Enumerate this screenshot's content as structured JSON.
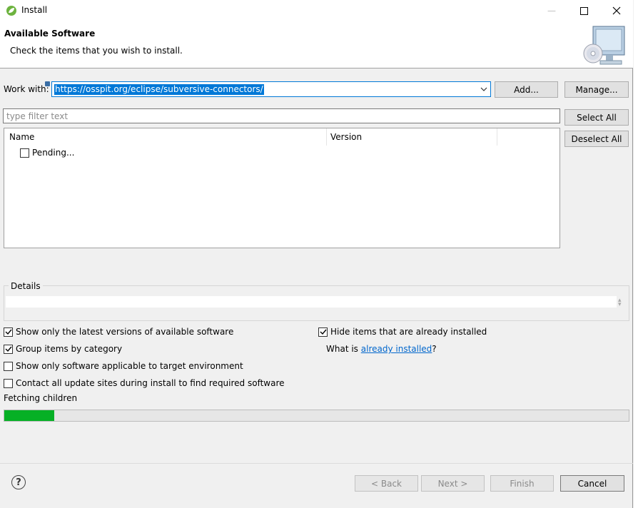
{
  "window": {
    "title": "Install",
    "minimize_glyph": "—",
    "maximize_glyph": "☐",
    "close_glyph": "✕"
  },
  "header": {
    "title": "Available Software",
    "subtitle": "Check the items that you wish to install."
  },
  "work_with": {
    "label": "Work with:",
    "value": "https://osspit.org/eclipse/subversive-connectors/",
    "add_label": "Add...",
    "manage_label": "Manage..."
  },
  "filter": {
    "placeholder": "type filter text"
  },
  "table": {
    "columns": [
      "Name",
      "Version"
    ],
    "rows": [
      {
        "name": "Pending...",
        "checked": false
      }
    ]
  },
  "selection_buttons": {
    "select_all": "Select All",
    "deselect_all": "Deselect All"
  },
  "details": {
    "label": "Details"
  },
  "options": {
    "latest_versions": {
      "label": "Show only the latest versions of available software",
      "checked": true
    },
    "group_by_category": {
      "label": "Group items by category",
      "checked": true
    },
    "applicable_only": {
      "label": "Show only software applicable to target environment",
      "checked": false
    },
    "contact_all_sites": {
      "label": "Contact all update sites during install to find required software",
      "checked": false
    },
    "hide_installed": {
      "label": "Hide items that are already installed",
      "checked": true
    },
    "what_is_prefix": "What is ",
    "already_installed_link": "already installed",
    "what_is_suffix": "?"
  },
  "status": {
    "text": "Fetching children",
    "progress_fraction": 0.08
  },
  "footer": {
    "help_glyph": "?",
    "back": "< Back",
    "next": "Next >",
    "finish": "Finish",
    "cancel": "Cancel"
  },
  "colors": {
    "accent": "#0078d7",
    "progress": "#06b025",
    "link": "#0066cc"
  }
}
